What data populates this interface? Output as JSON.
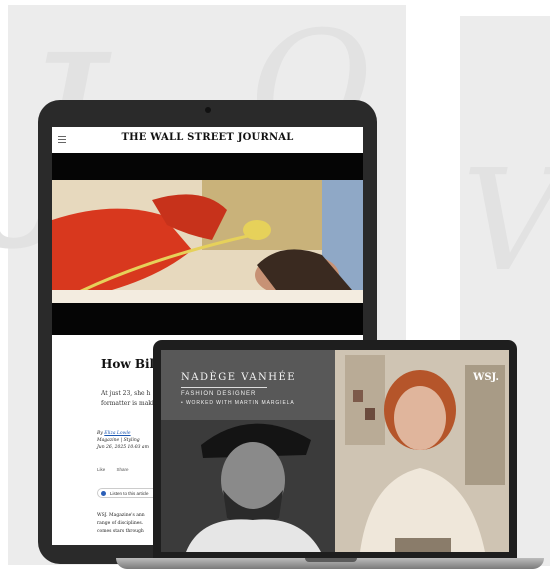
{
  "tablet": {
    "masthead": "THE WALL STREET JOURNAL",
    "article": {
      "title": "How Billi",
      "dek_line1": "At just 23, she h",
      "dek_line2": "formatter is maki",
      "byline_prefix": "By ",
      "byline_author": "Eliza Lowle",
      "byline_line2": "Magazine | Styling",
      "byline_line3": "Jun 26, 2025 10:03 am",
      "tool_like": "Like",
      "tool_share": "Share",
      "listen_label": "Listen to this article",
      "body_line1": "WSJ. Magazine's ann",
      "body_line2": "range of disciplines.",
      "body_line3": "comes stars through"
    }
  },
  "laptop": {
    "overlay_name": "NADÈGE VANHÉE",
    "overlay_role": "FASHION DESIGNER",
    "overlay_sub": "• WORKED WITH MARTIN MARGIELA",
    "logo": "WSJ."
  },
  "icons": {
    "menu": "hamburger-menu-icon",
    "listen": "play-audio-icon"
  },
  "colors": {
    "accent_blue": "#2b5fb8",
    "dress_red": "#d8381e",
    "phone_yellow": "#e6d15a"
  }
}
